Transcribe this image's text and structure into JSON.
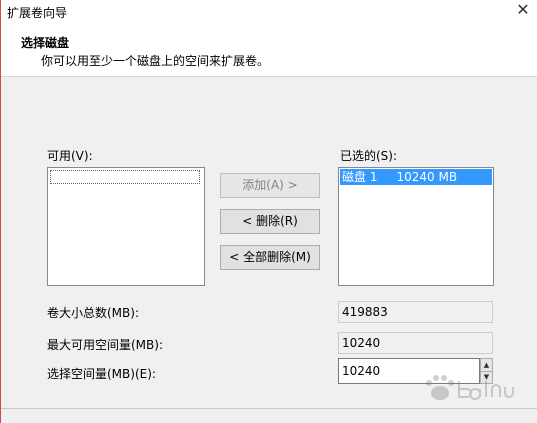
{
  "window": {
    "title": "扩展卷向导",
    "close_glyph": "✕"
  },
  "header": {
    "title": "选择磁盘",
    "subtitle": "你可以用至少一个磁盘上的空间来扩展卷。"
  },
  "available": {
    "label": "可用(V):",
    "items": []
  },
  "selected": {
    "label": "已选的(S):",
    "items": [
      {
        "disk": "磁盘 1",
        "size": "10240 MB",
        "text": "磁盘 1     10240 MB"
      }
    ]
  },
  "buttons": {
    "add": "添加(A) >",
    "remove": "< 删除(R)",
    "remove_all": "< 全部删除(M)"
  },
  "fields": {
    "total_size_label": "卷大小总数(MB):",
    "total_size_value": "419883",
    "max_space_label": "最大可用空间量(MB):",
    "max_space_value": "10240",
    "select_space_label": "选择空间量(MB)(E):",
    "select_space_value": "10240"
  },
  "colors": {
    "selection": "#3399ff",
    "window_bg": "#f0f0f0"
  }
}
